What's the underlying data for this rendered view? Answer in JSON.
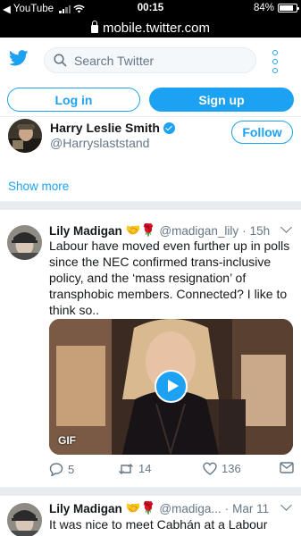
{
  "status_bar": {
    "back_app": "YouTube",
    "time": "00:15",
    "battery": "84%"
  },
  "browser": {
    "url": "mobile.twitter.com"
  },
  "header": {
    "search_placeholder": "Search Twitter",
    "login_label": "Log in",
    "signup_label": "Sign up"
  },
  "suggested_account": {
    "name": "Harry Leslie Smith",
    "handle": "@Harryslaststand",
    "follow_label": "Follow"
  },
  "show_more_label": "Show more",
  "tweets": [
    {
      "name": "Lily Madigan",
      "emoji": "🤝🌹",
      "handle": "@madigan_lily",
      "separator": "·",
      "time": "15h",
      "lines": [
        "Labour have moved even further up in polls",
        "since the NEC confirmed trans-inclusive",
        "policy, and the ‘mass resignation’ of",
        "transphobic members. Connected? I like to",
        "think so.."
      ],
      "media_badge": "GIF",
      "reply_count": "5",
      "retweet_count": "14",
      "like_count": "136"
    },
    {
      "name": "Lily Madigan",
      "emoji": "🤝🌹",
      "handle": "@madiga...",
      "separator": "·",
      "time": "Mar 11",
      "lines": [
        "It was nice to meet Cabhán at a Labour event"
      ]
    }
  ],
  "colors": {
    "accent": "#1da1f2",
    "text": "#14171a",
    "secondary_text": "#657786",
    "divider": "#e6ecf0"
  }
}
